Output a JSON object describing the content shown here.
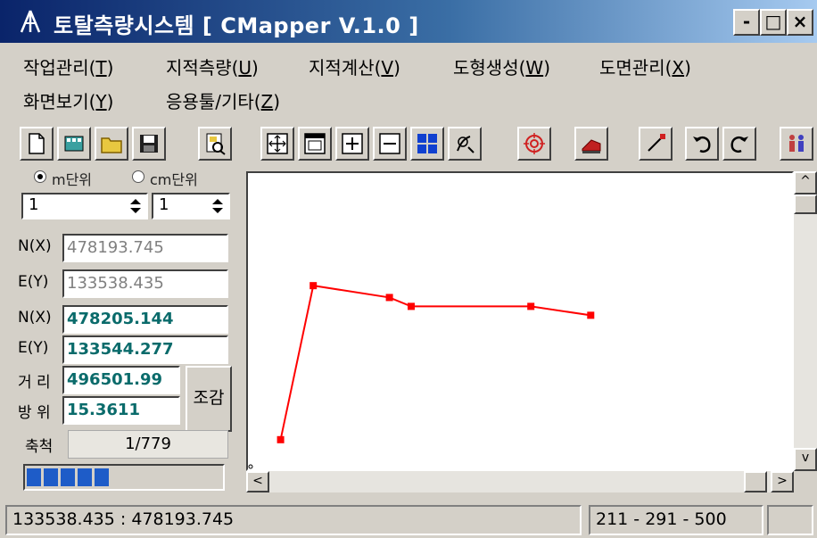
{
  "window": {
    "title": "토탈측량시스템 [ CMapper V.1.0 ]",
    "minimize": "-",
    "maximize": "□",
    "close": "×"
  },
  "menu": {
    "row1": [
      {
        "text": "작업관리(",
        "mn": "T",
        "end": ")"
      },
      {
        "text": "지적측량(",
        "mn": "U",
        "end": ")"
      },
      {
        "text": "지적계산(",
        "mn": "V",
        "end": ")"
      },
      {
        "text": "도형생성(",
        "mn": "W",
        "end": ")"
      },
      {
        "text": "도면관리(",
        "mn": "X",
        "end": ")"
      }
    ],
    "row2": [
      {
        "text": "화면보기(",
        "mn": "Y",
        "end": ")"
      },
      {
        "text": "응용툴/기타(",
        "mn": "Z",
        "end": ")"
      }
    ]
  },
  "toolbar": {
    "icons": [
      "new-file-icon",
      "film-icon",
      "open-folder-icon",
      "save-icon",
      "print-preview-icon",
      "zoom-fit-icon",
      "window-icon",
      "zoom-in-icon",
      "zoom-out-icon",
      "grid-icon",
      "select-icon",
      "target-icon",
      "layer-icon",
      "line-icon",
      "undo-icon",
      "redo-icon",
      "people-icon"
    ]
  },
  "panel": {
    "unit_m": "m단위",
    "unit_cm": "cm단위",
    "spin1": "1",
    "spin2": "1",
    "n1_label": "N(X)",
    "n1_value": "478193.745",
    "e1_label": "E(Y)",
    "e1_value": "133538.435",
    "n2_label": "N(X)",
    "n2_value": "478205.144",
    "e2_label": "E(Y)",
    "e2_value": "133544.277",
    "dist_label": "거 리",
    "dist_value": "496501.99",
    "bearing_label": "방 위",
    "bearing_value": "15.3611",
    "adjust_button": "조감",
    "scale_label": "축척",
    "scale_value": "1/779",
    "progress_blocks": 5
  },
  "canvas": {
    "line_color": "#ff0000",
    "polyline": [
      [
        0.06,
        0.9
      ],
      [
        0.12,
        0.38
      ],
      [
        0.26,
        0.42
      ],
      [
        0.3,
        0.45
      ],
      [
        0.52,
        0.45
      ],
      [
        0.63,
        0.48
      ]
    ]
  },
  "statusbar": {
    "coords": "133538.435 : 478193.745",
    "range": "211 - 291 - 500"
  },
  "scroll": {
    "up": "^",
    "down": "v",
    "left": "<",
    "right": ">"
  }
}
